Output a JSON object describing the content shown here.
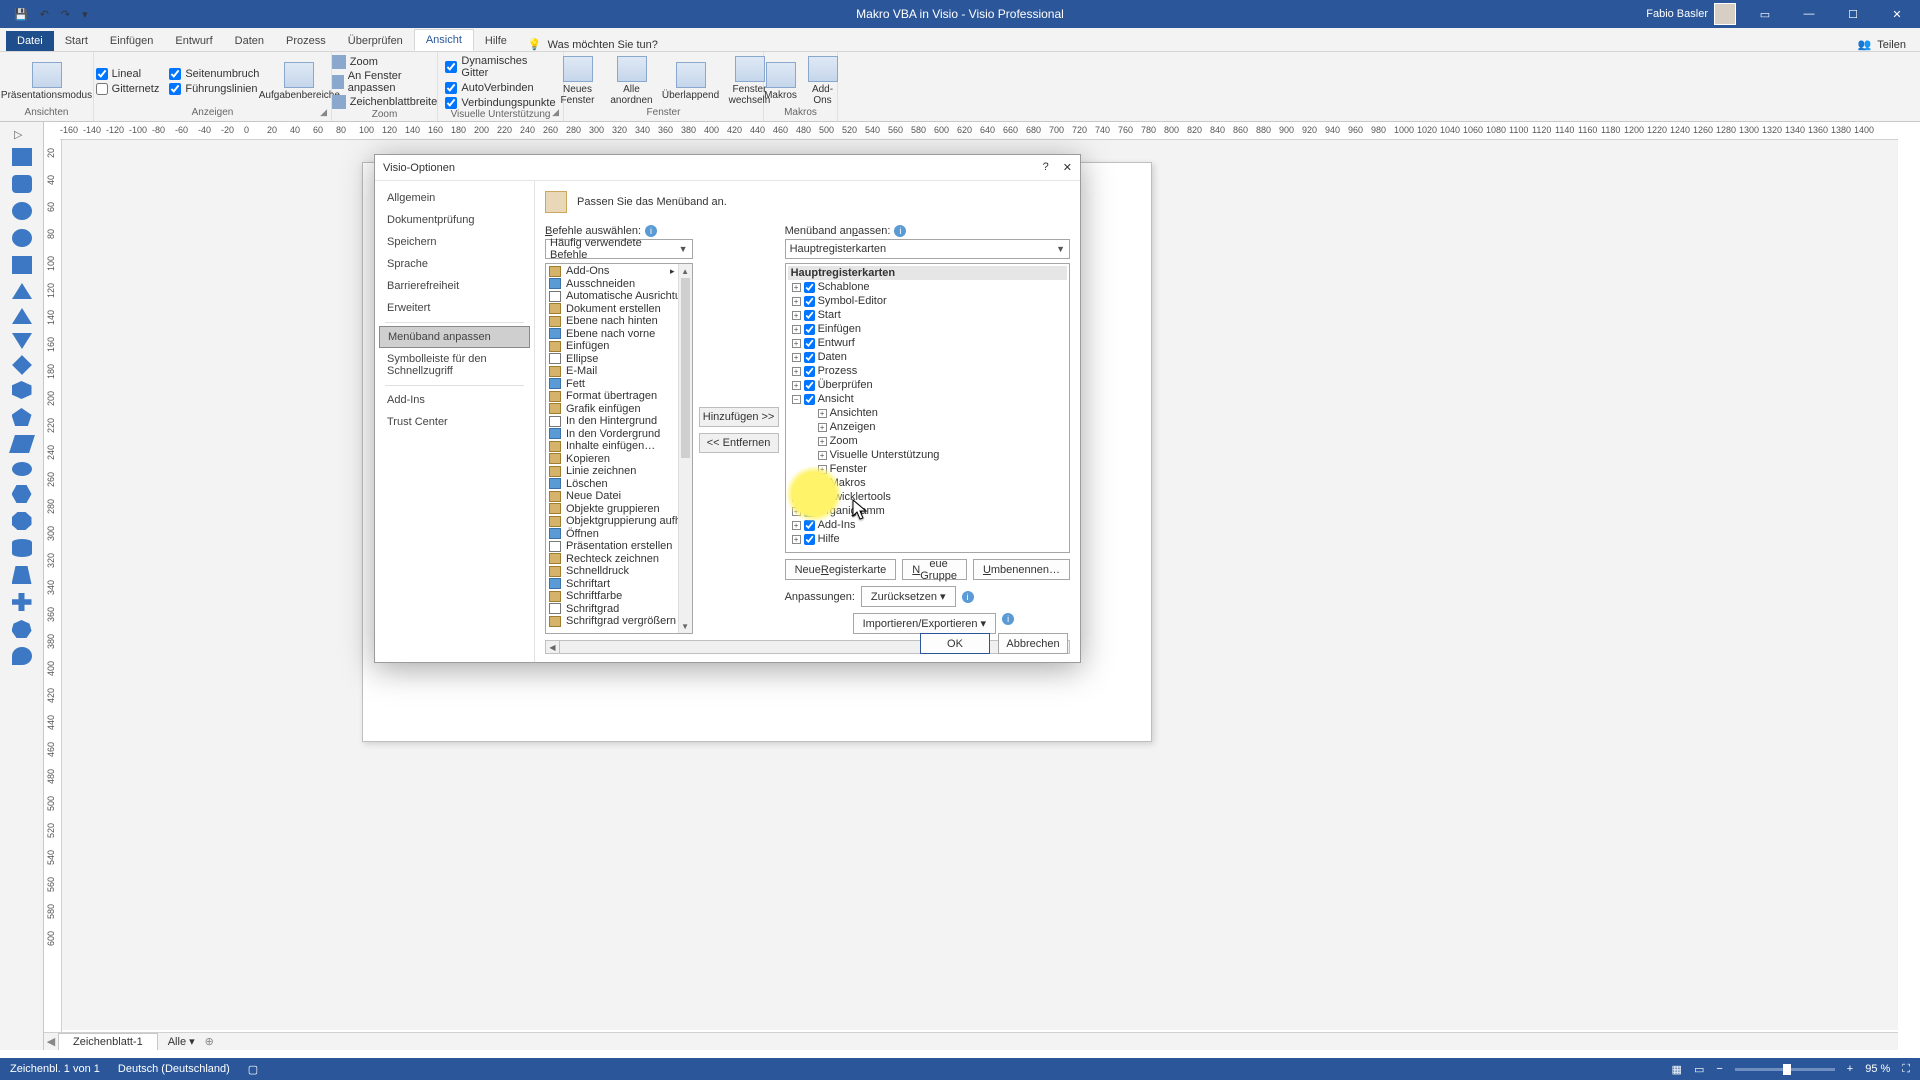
{
  "titlebar": {
    "title": "Makro VBA in Visio - Visio Professional",
    "user": "Fabio Basler",
    "qat": {
      "save": "💾",
      "undo": "↶",
      "redo": "↷",
      "more": "▾"
    },
    "win": {
      "a": "▭",
      "min": "—",
      "max": "☐",
      "close": "✕"
    }
  },
  "tabs": {
    "items": [
      "Datei",
      "Start",
      "Einfügen",
      "Entwurf",
      "Daten",
      "Prozess",
      "Überprüfen",
      "Ansicht",
      "Hilfe"
    ],
    "active": "Ansicht",
    "tellme_icon": "💡",
    "tellme": "Was möchten Sie tun?",
    "share_icon": "👥",
    "share": "Teilen"
  },
  "ribbon": {
    "g1": {
      "btn": "Präsentationsmodus",
      "label": "Ansichten"
    },
    "g2": {
      "c1": "Lineal",
      "c2": "Seitenumbruch",
      "c3": "Gitternetz",
      "c4": "Führungslinien",
      "btn": "Aufgabenbereiche",
      "label": "Anzeigen"
    },
    "g3": {
      "r1": "Zoom",
      "r2": "An Fenster anpassen",
      "r3": "Zeichenblattbreite",
      "label": "Zoom"
    },
    "g4": {
      "r1": "Dynamisches Gitter",
      "r2": "AutoVerbinden",
      "r3": "Verbindungspunkte",
      "label": "Visuelle Unterstützung"
    },
    "g5": {
      "b1": "Neues\nFenster",
      "b2": "Alle\nanordnen",
      "b3": "Überlappend",
      "b4": "Fenster\nwechseln",
      "label": "Fenster"
    },
    "g6": {
      "b1": "Makros",
      "b2": "Add-\nOns",
      "label": "Makros"
    }
  },
  "ruler_h": [
    "-160",
    "-140",
    "-120",
    "-100",
    "-80",
    "-60",
    "-40",
    "-20",
    "0",
    "20",
    "40",
    "60",
    "80",
    "100",
    "120",
    "140",
    "160",
    "180",
    "200",
    "220",
    "240",
    "260",
    "280",
    "300",
    "320",
    "340",
    "360",
    "380",
    "400",
    "420",
    "440",
    "460",
    "480",
    "500",
    "520",
    "540",
    "560",
    "580",
    "600",
    "620",
    "640",
    "660",
    "680",
    "700",
    "720",
    "740",
    "760",
    "780",
    "800",
    "820",
    "840",
    "860",
    "880",
    "900",
    "920",
    "940",
    "960",
    "980",
    "1000",
    "1020",
    "1040",
    "1060",
    "1080",
    "1100",
    "1120",
    "1140",
    "1160",
    "1180",
    "1200",
    "1220",
    "1240",
    "1260",
    "1280",
    "1300",
    "1320",
    "1340",
    "1360",
    "1380",
    "1400"
  ],
  "ruler_v": [
    "20",
    "40",
    "60",
    "80",
    "100",
    "120",
    "140",
    "160",
    "180",
    "200",
    "220",
    "240",
    "260",
    "280",
    "300",
    "320",
    "340",
    "360",
    "380",
    "400",
    "420",
    "440",
    "460",
    "480",
    "500",
    "520",
    "540",
    "560",
    "580",
    "600"
  ],
  "dialog": {
    "title": "Visio-Optionen",
    "help": "?",
    "close": "✕",
    "nav": [
      "Allgemein",
      "Dokumentprüfung",
      "Speichern",
      "Sprache",
      "Barrierefreiheit",
      "Erweitert",
      "Menüband anpassen",
      "Symbolleiste für den Schnellzugriff",
      "Add-Ins",
      "Trust Center"
    ],
    "nav_selected": "Menüband anpassen",
    "heading": "Passen Sie das Menüband an.",
    "left": {
      "label": "Befehle auswählen:",
      "combo": "Häufig verwendete Befehle",
      "items": [
        "Add-Ons",
        "Ausschneiden",
        "Automatische Ausrichtung und…",
        "Dokument erstellen",
        "Ebene nach hinten",
        "Ebene nach vorne",
        "Einfügen",
        "Ellipse",
        "E-Mail",
        "Fett",
        "Format übertragen",
        "Grafik einfügen",
        "In den Hintergrund",
        "In den Vordergrund",
        "Inhalte einfügen…",
        "Kopieren",
        "Linie zeichnen",
        "Löschen",
        "Neue Datei",
        "Objekte gruppieren",
        "Objektgruppierung aufheben",
        "Öffnen",
        "Präsentation erstellen",
        "Rechteck zeichnen",
        "Schnelldruck",
        "Schriftart",
        "Schriftfarbe",
        "Schriftgrad",
        "Schriftgrad vergrößern"
      ]
    },
    "mid": {
      "add": "Hinzufügen >>",
      "remove": "<< Entfernen"
    },
    "right": {
      "label": "Menüband anpassen:",
      "combo": "Hauptregisterkarten",
      "header": "Hauptregisterkarten",
      "nodes": [
        {
          "t": "Schablone",
          "c": true
        },
        {
          "t": "Symbol-Editor",
          "c": true
        },
        {
          "t": "Start",
          "c": true
        },
        {
          "t": "Einfügen",
          "c": true
        },
        {
          "t": "Entwurf",
          "c": true
        },
        {
          "t": "Daten",
          "c": true
        },
        {
          "t": "Prozess",
          "c": true
        },
        {
          "t": "Überprüfen",
          "c": true
        },
        {
          "t": "Ansicht",
          "c": true,
          "open": true,
          "children": [
            "Ansichten",
            "Anzeigen",
            "Zoom",
            "Visuelle Unterstützung",
            "Fenster",
            "Makros"
          ]
        },
        {
          "t": "Entwicklertools",
          "c": false
        },
        {
          "t": "Organigramm",
          "c": true
        },
        {
          "t": "Add-Ins",
          "c": true
        },
        {
          "t": "Hilfe",
          "c": true
        }
      ],
      "btn1": "Neue Registerkarte",
      "btn2": "Neue Gruppe",
      "btn3": "Umbenennen…",
      "cust": "Anpassungen:",
      "reset": "Zurücksetzen ▾",
      "imp": "Importieren/Exportieren ▾"
    },
    "ok": "OK",
    "cancel": "Abbrechen"
  },
  "sheets": {
    "tab": "Zeichenblatt-1",
    "all": "Alle ▾",
    "add": "⊕"
  },
  "status": {
    "page": "Zeichenbl. 1 von 1",
    "lang": "Deutsch (Deutschland)",
    "rec": "▢",
    "zoom": "95 %",
    "fit": "⛶"
  }
}
